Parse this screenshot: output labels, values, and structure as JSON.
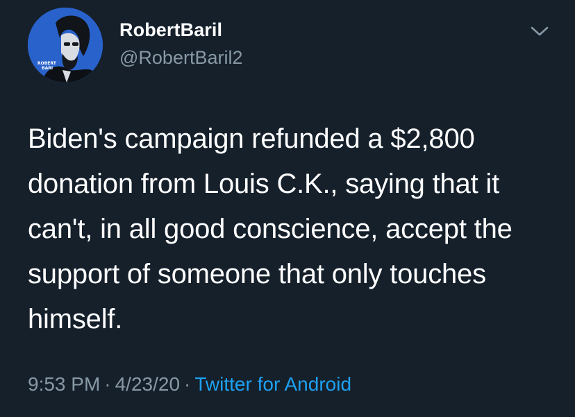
{
  "author": {
    "display_name": "RobertBaril",
    "handle": "@RobertBaril2",
    "avatar_text_line1": "ROBERT",
    "avatar_text_line2": "BARI"
  },
  "tweet": {
    "text": "Biden's campaign refunded a $2,800 donation from Louis C.K., saying that it can't, in all good conscience, accept the support of someone that only touches himself."
  },
  "meta": {
    "time": "9:53 PM",
    "separator": "·",
    "date": "4/23/20",
    "source": "Twitter for Android"
  },
  "icons": {
    "menu": "chevron-down-icon"
  },
  "colors": {
    "background": "#15202b",
    "text_primary": "#ffffff",
    "text_secondary": "#8899a6",
    "link": "#1da1f2"
  }
}
